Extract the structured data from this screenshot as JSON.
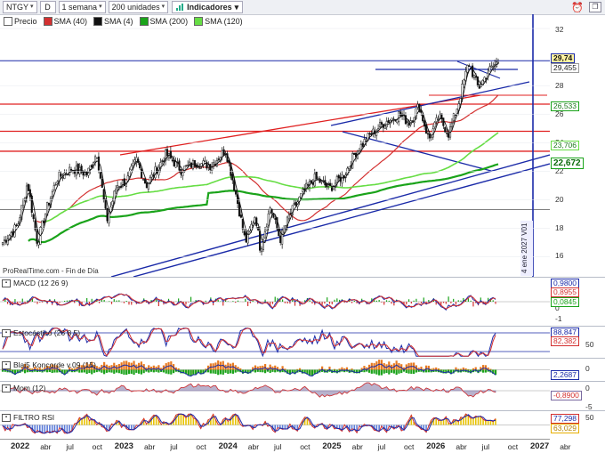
{
  "toolbar": {
    "symbol": "NTGY",
    "d_button": "D",
    "period": "1 semana",
    "units": "200 unidades",
    "indicators": "Indicadores"
  },
  "legend": [
    {
      "label": "Precio",
      "color": "#ffffff"
    },
    {
      "label": "SMA (40)",
      "color": "#d33030"
    },
    {
      "label": "SMA (4)",
      "color": "#111111"
    },
    {
      "label": "SMA (200)",
      "color": "#1aa31a"
    },
    {
      "label": "SMA (120)",
      "color": "#66dd44"
    }
  ],
  "watermark": "ProRealTime.com - Fin de Día",
  "vertical_label": "4 ene 2027 V01",
  "price_axis": {
    "ticks": [
      "32",
      "28",
      "26",
      "24",
      "22",
      "20",
      "18",
      "16"
    ],
    "last_price": "29,74",
    "price2": "29,455",
    "sma40_value": "26,533",
    "sma120_value": "23,706",
    "sma200_value": "22,672"
  },
  "panels": {
    "macd": {
      "label": "MACD (12 26 9)",
      "ticks": [
        "1",
        "0",
        "-1"
      ],
      "values": [
        "0,9800",
        "0,8955",
        "0,0845"
      ]
    },
    "stoch": {
      "label": "Estocástico (26 8 5)",
      "ticks": [
        "50"
      ],
      "values": [
        "88,847",
        "82,382"
      ]
    },
    "koncorde": {
      "label": "Blai5 Koncorde v.09 (15)",
      "ticks": [
        "0"
      ],
      "values": [
        "2,2687"
      ]
    },
    "mom": {
      "label": "Mom (12)",
      "ticks": [
        "0",
        "-5"
      ],
      "values": [
        "-0,8900"
      ]
    },
    "rsi": {
      "label": "FILTRO RSI",
      "ticks": [
        "50"
      ],
      "values": [
        "77,298",
        "63,029"
      ]
    }
  },
  "xaxis": [
    {
      "label": "2022",
      "year": true
    },
    {
      "label": "abr"
    },
    {
      "label": "jul"
    },
    {
      "label": "oct"
    },
    {
      "label": "2023",
      "year": true
    },
    {
      "label": "abr"
    },
    {
      "label": "jul"
    },
    {
      "label": "oct"
    },
    {
      "label": "2024",
      "year": true
    },
    {
      "label": "abr"
    },
    {
      "label": "jul"
    },
    {
      "label": "oct"
    },
    {
      "label": "2025",
      "year": true
    },
    {
      "label": "abr"
    },
    {
      "label": "jul"
    },
    {
      "label": "oct"
    },
    {
      "label": "2026",
      "year": true
    },
    {
      "label": "abr"
    },
    {
      "label": "jul"
    },
    {
      "label": "oct"
    },
    {
      "label": "2027",
      "year": true
    },
    {
      "label": "abr"
    }
  ],
  "colors": {
    "price_line_blue": "#1a2aa8",
    "resistance_red": "#e02020",
    "trend_blue": "#1a2aa8",
    "macd": "#1a2aa8",
    "signal": "#d33030"
  }
}
